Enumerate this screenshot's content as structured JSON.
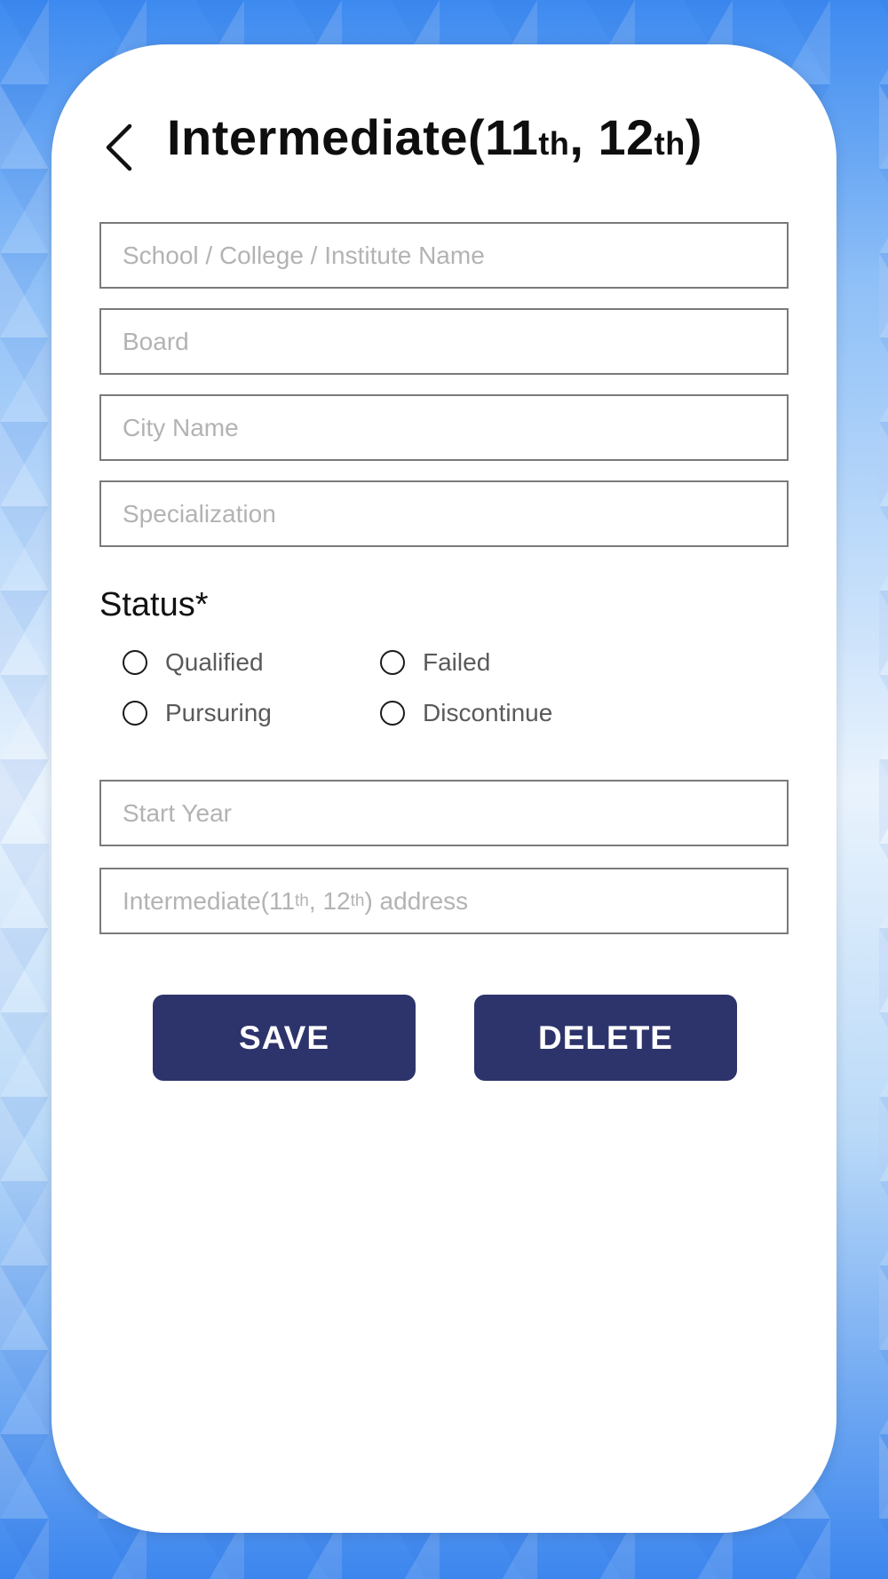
{
  "header": {
    "title_main": "Intermediate(11",
    "title_sup1": "th",
    "title_mid": ", 12",
    "title_sup2": "th",
    "title_end": ")"
  },
  "form": {
    "school_placeholder": "School / College / Institute Name",
    "board_placeholder": "Board",
    "city_placeholder": "City Name",
    "specialization_placeholder": "Specialization",
    "start_year_placeholder": "Start Year",
    "address_placeholder": {
      "part1": "Intermediate(11",
      "sup1": "th",
      "part2": ", 12",
      "sup2": "th",
      "part3": ") address"
    }
  },
  "status": {
    "label": "Status*",
    "options": [
      "Qualified",
      "Failed",
      "Pursuring",
      "Discontinue"
    ]
  },
  "actions": {
    "save_label": "SAVE",
    "delete_label": "DELETE"
  },
  "colors": {
    "button": "#2d336b",
    "background_accent": "#3d8af0"
  }
}
